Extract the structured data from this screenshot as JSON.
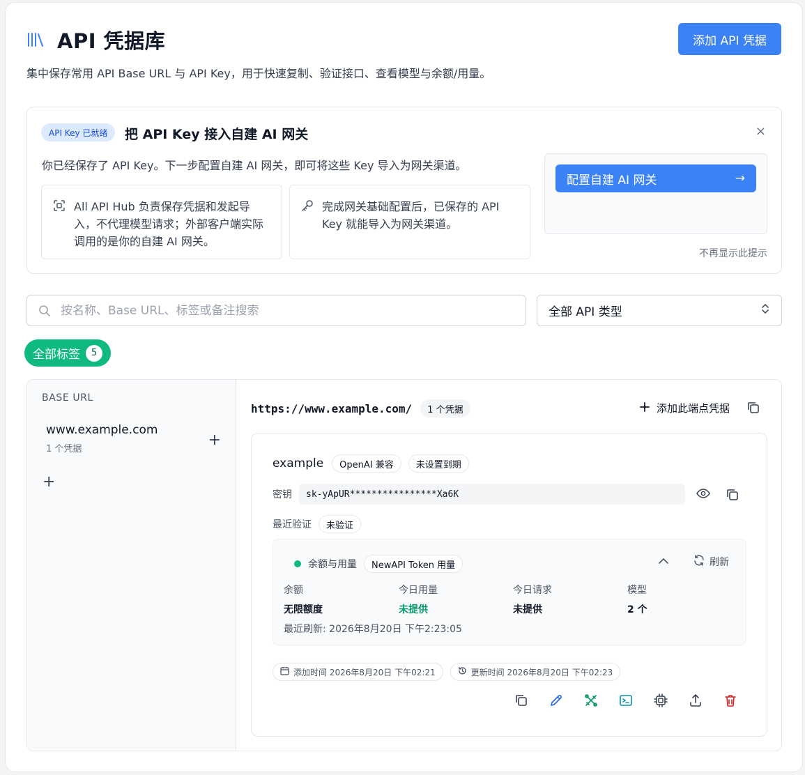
{
  "header": {
    "title": "API 凭据库",
    "subtitle": "集中保存常用 API Base URL 与 API Key，用于快速复制、验证接口、查看模型与余额/用量。",
    "add_button": "添加 API 凭据"
  },
  "banner": {
    "badge": "API Key 已就绪",
    "title": "把 API Key 接入自建 AI 网关",
    "close": "×",
    "description": "你已经保存了 API Key。下一步配置自建 AI 网关，即可将这些 Key 导入为网关渠道。",
    "info_1": "All API Hub 负责保存凭据和发起导入，不代理模型请求；外部客户端实际调用的是你的自建 AI 网关。",
    "info_2": "完成网关基础配置后，已保存的 API Key 就能导入为网关渠道。",
    "cta": "配置自建 AI 网关",
    "cta_arrow": "→",
    "dismiss": "不再显示此提示"
  },
  "search": {
    "placeholder": "按名称、Base URL、标签或备注搜索",
    "type_value": "全部 API 类型"
  },
  "tags": {
    "all_label": "全部标签",
    "all_count": "5"
  },
  "sidebar": {
    "heading": "BASE URL",
    "items": [
      {
        "host": "www.example.com",
        "count": "1 个凭据"
      }
    ],
    "plus": "+"
  },
  "endpoint": {
    "url": "https://www.example.com/",
    "count": "1 个凭据",
    "add_label": "添加此端点凭据"
  },
  "credential": {
    "name": "example",
    "type_chip": "OpenAI 兼容",
    "expiry_chip": "未设置到期",
    "key_label": "密钥",
    "key_value": "sk-yApUR****************Xa6K",
    "verify_label": "最近验证",
    "verify_status": "未验证",
    "usage": {
      "title": "余额与用量",
      "source_chip": "NewAPI Token 用量",
      "refresh": "刷新",
      "stats": [
        {
          "key": "余额",
          "value": "无限额度"
        },
        {
          "key": "今日用量",
          "value": "未提供"
        },
        {
          "key": "今日请求",
          "value": "未提供"
        },
        {
          "key": "模型",
          "value": "2 个"
        }
      ],
      "last_refresh": "最近刷新: 2026年8月20日 下午2:23:05"
    },
    "added_time": "添加时间 2026年8月20日 下午02:21",
    "updated_time": "更新时间 2026年8月20日 下午02:23"
  },
  "colors": {
    "primary": "#3b82f6",
    "success": "#10b981",
    "success_text": "#059669",
    "danger": "#dc2626",
    "teal": "#0891b2",
    "green_icon": "#059669"
  }
}
